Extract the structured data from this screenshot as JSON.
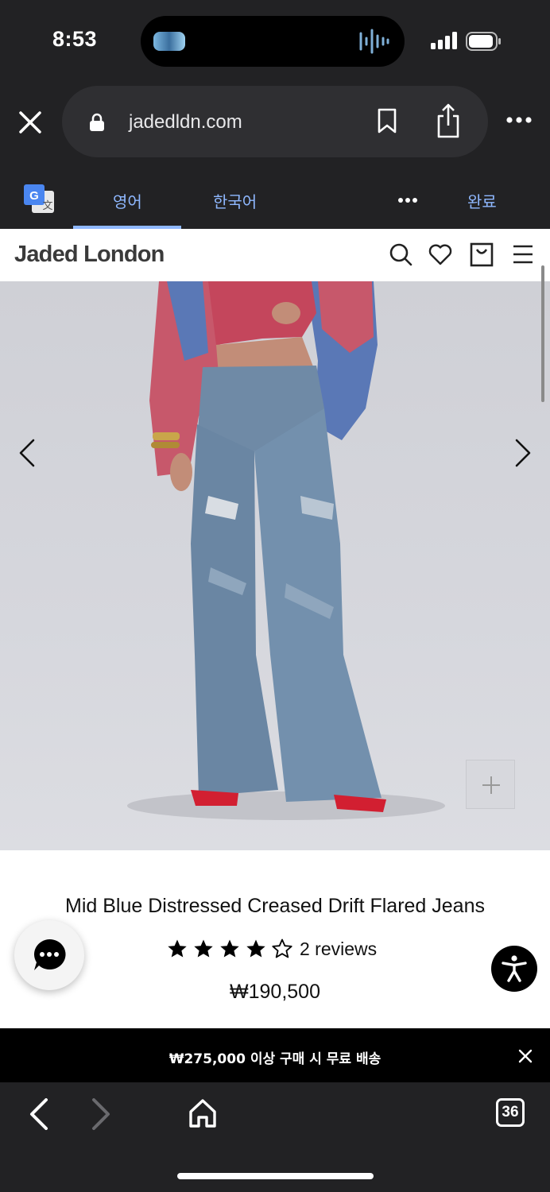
{
  "status_bar": {
    "time": "8:53"
  },
  "browser": {
    "url": "jadedldn.com",
    "tab_count": "36"
  },
  "translate_bar": {
    "source_lang": "영어",
    "target_lang": "한국어",
    "done_label": "완료"
  },
  "site": {
    "logo": "Jaded London"
  },
  "product": {
    "title": "Mid Blue Distressed Creased Drift Flared Jeans",
    "rating": 4,
    "rating_max": 5,
    "reviews_label": "2 reviews",
    "price": "₩190,500"
  },
  "promo": {
    "text": "₩275,000 이상 구매 시 무료 배송"
  },
  "colors": {
    "browser_bg": "#222224",
    "accent_blue": "#8fb8ff",
    "hero_bg": "#d3d4da",
    "denim": "#6f8aa6"
  },
  "icons": {
    "close": "close-icon",
    "lock": "lock-icon",
    "bookmark": "bookmark-icon",
    "share": "share-icon",
    "more": "more-icon",
    "search": "search-icon",
    "heart": "heart-icon",
    "bag": "shopping-bag-icon",
    "menu": "menu-icon",
    "chat": "chat-icon",
    "accessibility": "accessibility-icon"
  }
}
